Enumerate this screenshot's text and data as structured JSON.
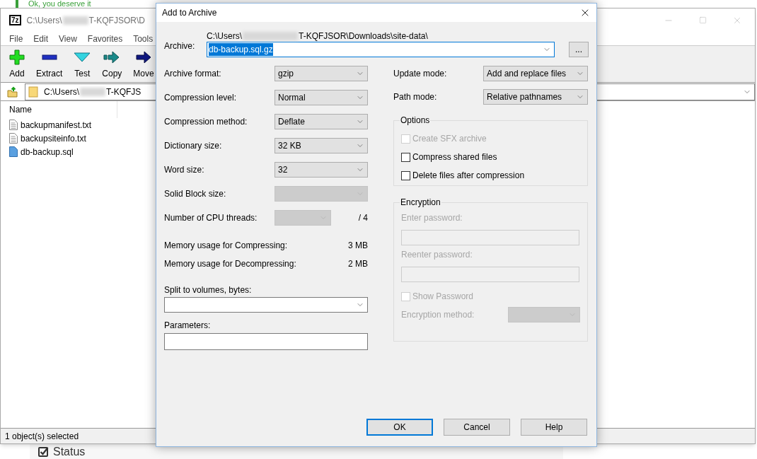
{
  "background_page": {
    "top_text": "Ok, you deserve it",
    "bottom_item": {
      "label": "Status",
      "checked": true
    }
  },
  "main_window": {
    "logo": "7z",
    "title_parts": [
      "C:\\Users\\",
      "T-KQFJSOR\\D"
    ],
    "menu": [
      "File",
      "Edit",
      "View",
      "Favorites",
      "Tools"
    ],
    "toolbar": [
      {
        "label": "Add",
        "kind": "add"
      },
      {
        "label": "Extract",
        "kind": "extract"
      },
      {
        "label": "Test",
        "kind": "test"
      },
      {
        "label": "Copy",
        "kind": "copy"
      },
      {
        "label": "Move",
        "kind": "move"
      }
    ],
    "address_parts": [
      "C:\\Users\\",
      "T-KQFJS"
    ],
    "list_header": "Name",
    "files": [
      {
        "name": "backupmanifest.txt",
        "kind": "text"
      },
      {
        "name": "backupsiteinfo.txt",
        "kind": "text"
      },
      {
        "name": "db-backup.sql",
        "kind": "sql"
      }
    ],
    "status": "1 object(s) selected"
  },
  "dialog": {
    "title": "Add to Archive",
    "archive": {
      "label": "Archive:",
      "path_parts": [
        "C:\\Users\\",
        "T-KQFJSOR\\Downloads\\site-data\\"
      ],
      "value": "db-backup.sql.gz",
      "value_selected": true,
      "browse": "..."
    },
    "left_rows": [
      {
        "kind": "select",
        "label": "Archive format:",
        "value": "gzip",
        "disabled": false
      },
      {
        "kind": "select",
        "label": "Compression level:",
        "value": "Normal",
        "disabled": false
      },
      {
        "kind": "select",
        "label": "Compression method:",
        "value": "Deflate",
        "disabled": false
      },
      {
        "kind": "select",
        "label": "Dictionary size:",
        "value": "32 KB",
        "disabled": false
      },
      {
        "kind": "select",
        "label": "Word size:",
        "value": "32",
        "disabled": false
      },
      {
        "kind": "select",
        "label": "Solid Block size:",
        "disabled": true
      },
      {
        "kind": "threads",
        "label": "Number of CPU threads:",
        "suffix": "/ 4",
        "disabled": true
      }
    ],
    "memory": [
      {
        "label": "Memory usage for Compressing:",
        "value": "3 MB"
      },
      {
        "label": "Memory usage for Decompressing:",
        "value": "2 MB"
      }
    ],
    "split": {
      "label": "Split to volumes, bytes:"
    },
    "parameters": {
      "label": "Parameters:"
    },
    "right_rows": [
      {
        "label": "Update mode:",
        "value": "Add and replace files"
      },
      {
        "label": "Path mode:",
        "value": "Relative pathnames"
      }
    ],
    "options": {
      "title": "Options",
      "items": [
        {
          "label": "Create SFX archive",
          "checked": false,
          "disabled": true
        },
        {
          "label": "Compress shared files",
          "checked": false,
          "disabled": false
        },
        {
          "label": "Delete files after compression",
          "checked": false,
          "disabled": false
        }
      ]
    },
    "encryption": {
      "title": "Encryption",
      "disabled": true,
      "fields": [
        {
          "label": "Enter password:"
        },
        {
          "label": "Reenter password:"
        }
      ],
      "show_password": {
        "label": "Show Password",
        "checked": false
      },
      "method_label": "Encryption method:"
    },
    "buttons": [
      {
        "label": "OK",
        "default": true
      },
      {
        "label": "Cancel",
        "default": false
      },
      {
        "label": "Help",
        "default": false
      }
    ]
  }
}
